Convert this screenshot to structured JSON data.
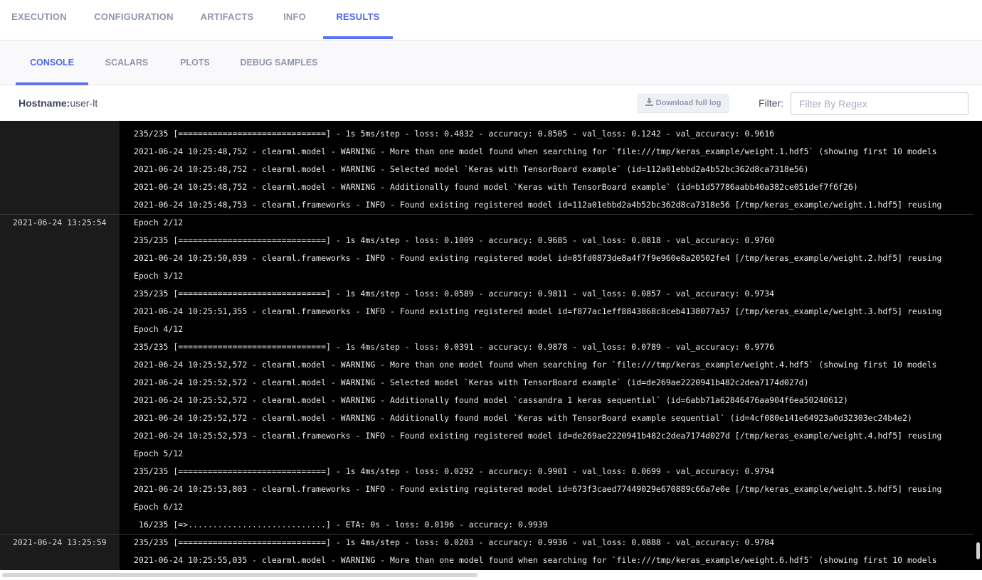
{
  "top_tabs": [
    {
      "label": "EXECUTION",
      "active": false
    },
    {
      "label": "CONFIGURATION",
      "active": false
    },
    {
      "label": "ARTIFACTS",
      "active": false
    },
    {
      "label": "INFO",
      "active": false
    },
    {
      "label": "RESULTS",
      "active": true
    }
  ],
  "sub_tabs": [
    {
      "label": "CONSOLE",
      "active": true
    },
    {
      "label": "SCALARS",
      "active": false
    },
    {
      "label": "PLOTS",
      "active": false
    },
    {
      "label": "DEBUG SAMPLES",
      "active": false
    }
  ],
  "toolbar": {
    "hostname_label": "Hostname:",
    "hostname_value": "user-lt",
    "download_label": "Download full log",
    "filter_label": "Filter:",
    "filter_placeholder": "Filter By Regex",
    "filter_value": ""
  },
  "log": {
    "groups": [
      {
        "timestamp": "",
        "lines": [
          "235/235 [==============================] - 1s 5ms/step - loss: 0.4832 - accuracy: 0.8505 - val_loss: 0.1242 - val_accuracy: 0.9616",
          "2021-06-24 10:25:48,752 - clearml.model - WARNING - More than one model found when searching for `file:///tmp/keras_example/weight.1.hdf5` (showing first 10 models",
          "2021-06-24 10:25:48,752 - clearml.model - WARNING - Selected model `Keras with TensorBoard example` (id=112a01ebbd2a4b52bc362d8ca7318e56)",
          "2021-06-24 10:25:48,752 - clearml.model - WARNING - Additionally found model `Keras with TensorBoard example` (id=b1d57786aabb40a382ce051def7f6f26)",
          "2021-06-24 10:25:48,753 - clearml.frameworks - INFO - Found existing registered model id=112a01ebbd2a4b52bc362d8ca7318e56 [/tmp/keras_example/weight.1.hdf5] reusing"
        ]
      },
      {
        "timestamp": "2021-06-24 13:25:54",
        "lines": [
          "Epoch 2/12",
          "235/235 [==============================] - 1s 4ms/step - loss: 0.1009 - accuracy: 0.9685 - val_loss: 0.0818 - val_accuracy: 0.9760",
          "2021-06-24 10:25:50,039 - clearml.frameworks - INFO - Found existing registered model id=85fd0873de8a4f7f9e960e8a20502fe4 [/tmp/keras_example/weight.2.hdf5] reusing",
          "Epoch 3/12",
          "235/235 [==============================] - 1s 4ms/step - loss: 0.0589 - accuracy: 0.9811 - val_loss: 0.0857 - val_accuracy: 0.9734",
          "2021-06-24 10:25:51,355 - clearml.frameworks - INFO - Found existing registered model id=f877ac1eff8843868c8ceb4138077a57 [/tmp/keras_example/weight.3.hdf5] reusing",
          "Epoch 4/12",
          "235/235 [==============================] - 1s 4ms/step - loss: 0.0391 - accuracy: 0.9878 - val_loss: 0.0789 - val_accuracy: 0.9776",
          "2021-06-24 10:25:52,572 - clearml.model - WARNING - More than one model found when searching for `file:///tmp/keras_example/weight.4.hdf5` (showing first 10 models",
          "2021-06-24 10:25:52,572 - clearml.model - WARNING - Selected model `Keras with TensorBoard example` (id=de269ae2220941b482c2dea7174d027d)",
          "2021-06-24 10:25:52,572 - clearml.model - WARNING - Additionally found model `cassandra 1 keras sequential` (id=6abb71a62846476aa904f6ea50240612)",
          "2021-06-24 10:25:52,572 - clearml.model - WARNING - Additionally found model `Keras with TensorBoard example sequential` (id=4cf080e141e64923a0d32303ec24b4e2)",
          "2021-06-24 10:25:52,573 - clearml.frameworks - INFO - Found existing registered model id=de269ae2220941b482c2dea7174d027d [/tmp/keras_example/weight.4.hdf5] reusing",
          "Epoch 5/12",
          "235/235 [==============================] - 1s 4ms/step - loss: 0.0292 - accuracy: 0.9901 - val_loss: 0.0699 - val_accuracy: 0.9794",
          "2021-06-24 10:25:53,803 - clearml.frameworks - INFO - Found existing registered model id=673f3caed77449029e670889c66a7e0e [/tmp/keras_example/weight.5.hdf5] reusing",
          "Epoch 6/12",
          " 16/235 [=>............................] - ETA: 0s - loss: 0.0196 - accuracy: 0.9939"
        ]
      },
      {
        "timestamp": "2021-06-24 13:25:59",
        "lines": [
          "235/235 [==============================] - 1s 4ms/step - loss: 0.0203 - accuracy: 0.9936 - val_loss: 0.0888 - val_accuracy: 0.9784",
          "2021-06-24 10:25:55,035 - clearml.model - WARNING - More than one model found when searching for `file:///tmp/keras_example/weight.6.hdf5` (showing first 10 models"
        ]
      }
    ]
  },
  "colors": {
    "accent": "#5a73f5",
    "inactive_tab": "#8f97ad",
    "log_background": "#000000",
    "timestamp_column": "#1b1b1b"
  }
}
